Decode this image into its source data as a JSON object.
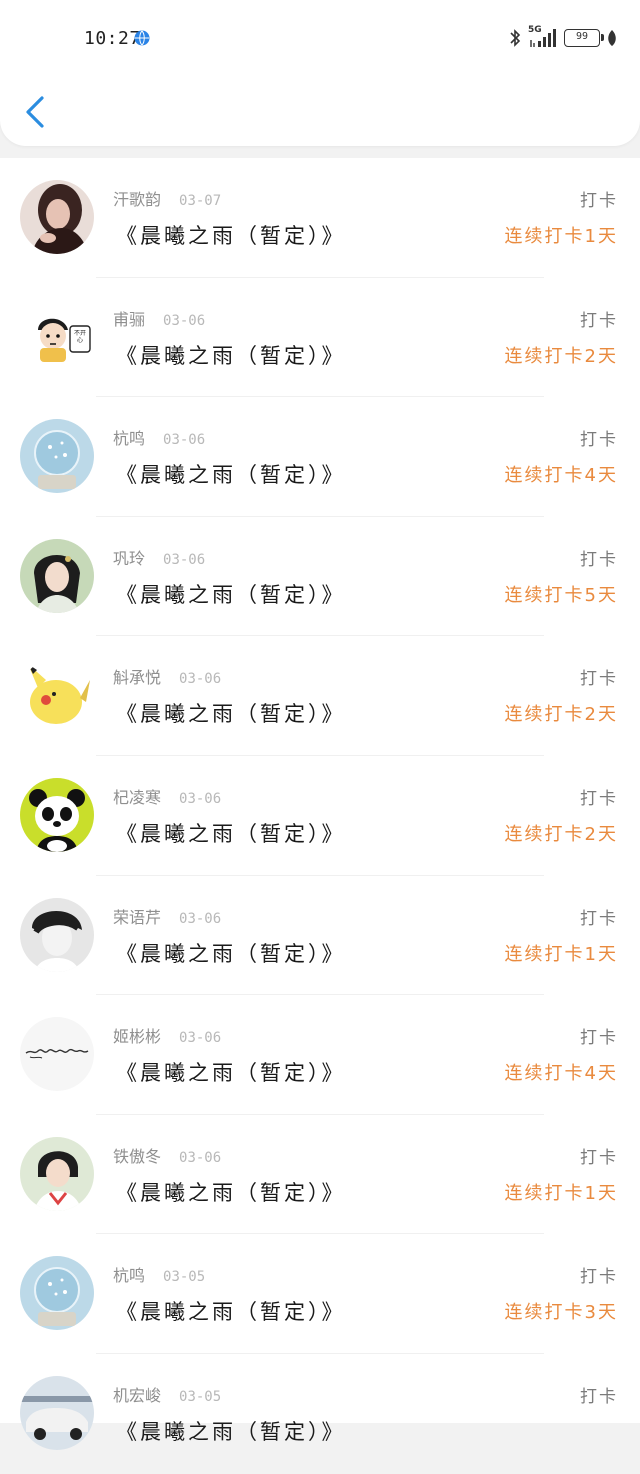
{
  "status_bar": {
    "time": "10:27",
    "network_label": "5G",
    "battery_level": "99"
  },
  "header": {
    "back_icon": "chevron-left-icon"
  },
  "list": {
    "items": [
      {
        "name": "汗歌韵",
        "date": "03-07",
        "title": "《晨曦之雨（暂定）》",
        "type": "打卡",
        "streak": "连续打卡1天",
        "avatar": "portrait-dark-hair"
      },
      {
        "name": "甫骊",
        "date": "03-06",
        "title": "《晨曦之雨（暂定）》",
        "type": "打卡",
        "streak": "连续打卡2天",
        "avatar": "cartoon-kid-sign",
        "avatar_sign": "不开心"
      },
      {
        "name": "杭鸣",
        "date": "03-06",
        "title": "《晨曦之雨（暂定）》",
        "type": "打卡",
        "streak": "连续打卡4天",
        "avatar": "snow-globe"
      },
      {
        "name": "巩玲",
        "date": "03-06",
        "title": "《晨曦之雨（暂定）》",
        "type": "打卡",
        "streak": "连续打卡5天",
        "avatar": "ancient-costume-woman"
      },
      {
        "name": "斛承悦",
        "date": "03-06",
        "title": "《晨曦之雨（暂定）》",
        "type": "打卡",
        "streak": "连续打卡2天",
        "avatar": "pikachu"
      },
      {
        "name": "杞凌寒",
        "date": "03-06",
        "title": "《晨曦之雨（暂定）》",
        "type": "打卡",
        "streak": "连续打卡2天",
        "avatar": "panda"
      },
      {
        "name": "荣语芹",
        "date": "03-06",
        "title": "《晨曦之雨（暂定）》",
        "type": "打卡",
        "streak": "连续打卡1天",
        "avatar": "bw-portrait"
      },
      {
        "name": "姬彬彬",
        "date": "03-06",
        "title": "《晨曦之雨（暂定）》",
        "type": "打卡",
        "streak": "连续打卡4天",
        "avatar": "handwriting"
      },
      {
        "name": "铁傲冬",
        "date": "03-06",
        "title": "《晨曦之雨（暂定）》",
        "type": "打卡",
        "streak": "连续打卡1天",
        "avatar": "girl-portrait"
      },
      {
        "name": "杭鸣",
        "date": "03-05",
        "title": "《晨曦之雨（暂定）》",
        "type": "打卡",
        "streak": "连续打卡3天",
        "avatar": "snow-globe"
      },
      {
        "name": "机宏峻",
        "date": "03-05",
        "title": "《晨曦之雨（暂定）》",
        "type": "打卡",
        "streak": "",
        "avatar": "car"
      }
    ]
  },
  "colors": {
    "streak": "#e98a3e",
    "back_arrow": "#2b8de0",
    "name": "#8f8f8f",
    "title": "#1a1a1a"
  }
}
